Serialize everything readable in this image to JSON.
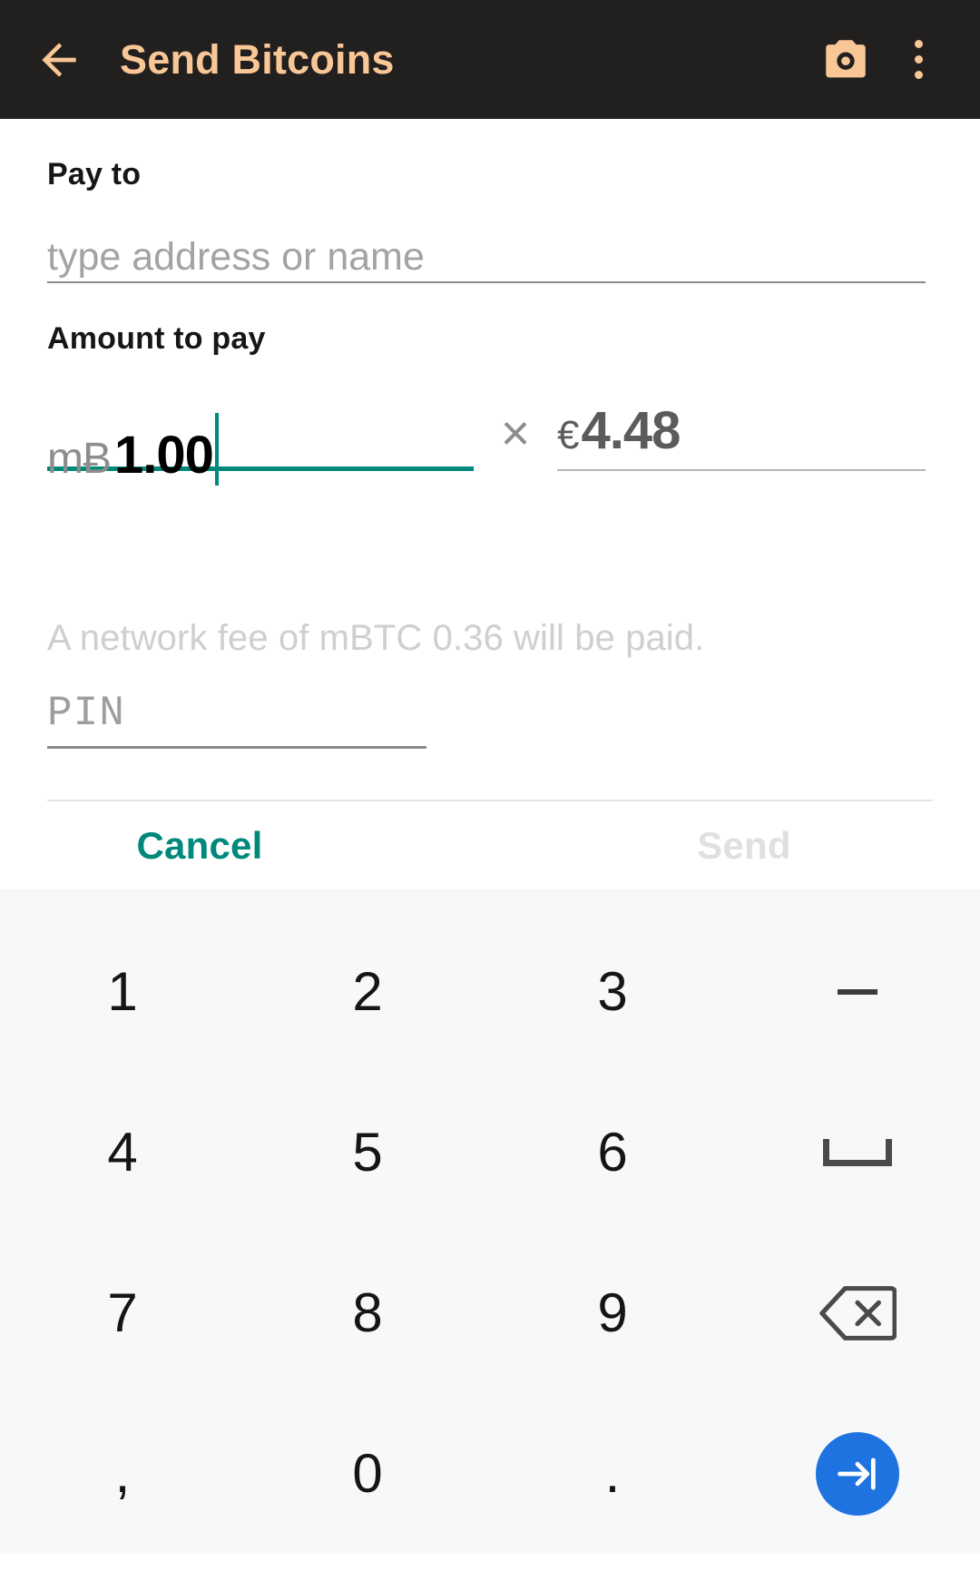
{
  "appbar": {
    "back_icon": "arrow-left-icon",
    "title": "Send Bitcoins",
    "camera_icon": "camera-icon",
    "overflow_icon": "overflow-menu-icon",
    "bg_color": "#221f1f",
    "accent_color": "#f9c795"
  },
  "form": {
    "payto": {
      "label": "Pay to",
      "placeholder": "type address or name",
      "value": ""
    },
    "amount": {
      "label": "Amount to pay",
      "btc_unit": "mɃ",
      "btc_value": "1.00",
      "separator": "×",
      "fiat_symbol": "€",
      "fiat_value": "4.48",
      "focus_color": "#00897b"
    },
    "fee_note": "A network fee of mBTC 0.36 will be paid.",
    "pin": {
      "placeholder": "PIN",
      "value": ""
    }
  },
  "buttons": {
    "cancel_label": "Cancel",
    "cancel_color": "#00897b",
    "send_label": "Send",
    "send_color": "#e0e0e0",
    "send_enabled": false
  },
  "keyboard": {
    "bg_color": "#f7f8fa",
    "enter_color": "#1f73e0",
    "rows": [
      [
        {
          "label": "1",
          "name": "key-1",
          "type": "digit"
        },
        {
          "label": "2",
          "name": "key-2",
          "type": "digit"
        },
        {
          "label": "3",
          "name": "key-3",
          "type": "digit"
        },
        {
          "label": "–",
          "name": "key-minus",
          "type": "minus"
        }
      ],
      [
        {
          "label": "4",
          "name": "key-4",
          "type": "digit"
        },
        {
          "label": "5",
          "name": "key-5",
          "type": "digit"
        },
        {
          "label": "6",
          "name": "key-6",
          "type": "digit"
        },
        {
          "label": "",
          "name": "key-space",
          "type": "space"
        }
      ],
      [
        {
          "label": "7",
          "name": "key-7",
          "type": "digit"
        },
        {
          "label": "8",
          "name": "key-8",
          "type": "digit"
        },
        {
          "label": "9",
          "name": "key-9",
          "type": "digit"
        },
        {
          "label": "",
          "name": "key-backspace",
          "type": "backspace"
        }
      ],
      [
        {
          "label": ",",
          "name": "key-comma",
          "type": "digit"
        },
        {
          "label": "0",
          "name": "key-0",
          "type": "digit"
        },
        {
          "label": ".",
          "name": "key-period",
          "type": "digit"
        },
        {
          "label": "",
          "name": "key-enter",
          "type": "enter"
        }
      ]
    ]
  }
}
